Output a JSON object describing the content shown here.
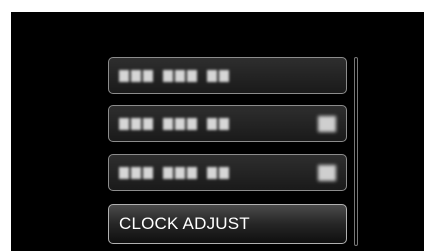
{
  "menu": {
    "items": [
      {
        "label": "",
        "obscured": true,
        "has_value": false
      },
      {
        "label": "",
        "obscured": true,
        "has_value": true
      },
      {
        "label": "",
        "obscured": true,
        "has_value": true
      },
      {
        "label": "CLOCK ADJUST",
        "obscured": false,
        "has_value": false,
        "selected": true
      }
    ]
  },
  "scrollbar": {
    "position": 0.55
  },
  "colors": {
    "background": "#000000",
    "item_border": "#8c8c8c",
    "text": "#ffffff"
  }
}
